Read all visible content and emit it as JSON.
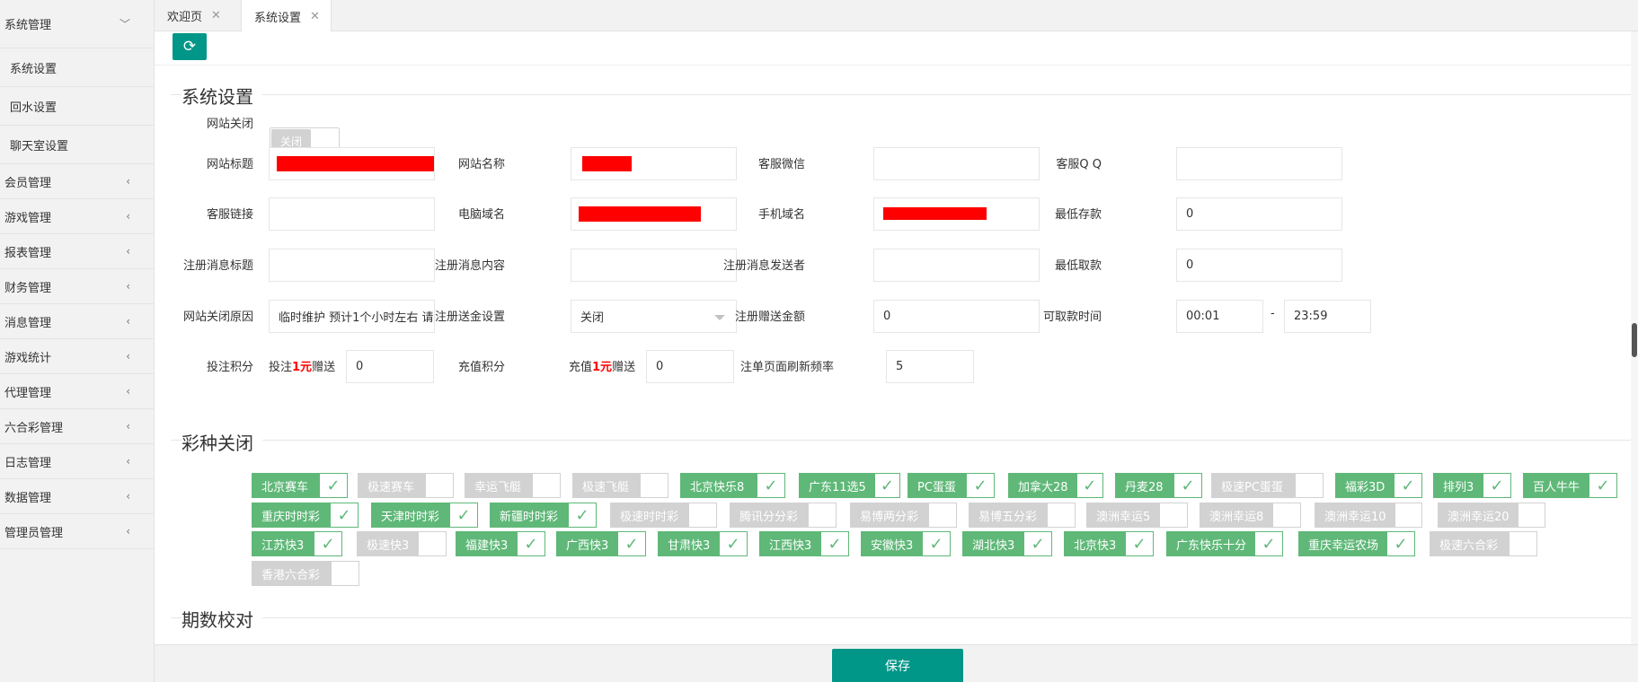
{
  "sidebar": {
    "items": [
      {
        "label": "系统管理",
        "arrow": "﹀"
      },
      {
        "label": "系统设置",
        "sub": true
      },
      {
        "label": "回水设置",
        "sub": true
      },
      {
        "label": "聊天室设置",
        "sub": true
      },
      {
        "label": "会员管理",
        "arrow": "‹"
      },
      {
        "label": "游戏管理",
        "arrow": "‹"
      },
      {
        "label": "报表管理",
        "arrow": "‹"
      },
      {
        "label": "财务管理",
        "arrow": "‹"
      },
      {
        "label": "消息管理",
        "arrow": "‹"
      },
      {
        "label": "游戏统计",
        "arrow": "‹"
      },
      {
        "label": "代理管理",
        "arrow": "‹"
      },
      {
        "label": "六合彩管理",
        "arrow": "‹"
      },
      {
        "label": "日志管理",
        "arrow": "‹"
      },
      {
        "label": "数据管理",
        "arrow": "‹"
      },
      {
        "label": "管理员管理",
        "arrow": "‹"
      }
    ]
  },
  "tabs": [
    {
      "label": "欢迎页",
      "close": "✕"
    },
    {
      "label": "系统设置",
      "close": "✕"
    }
  ],
  "refresh_icon": "⟳",
  "sections": {
    "system": "系统设置",
    "lottery": "彩种关闭",
    "period": "期数校对"
  },
  "form": {
    "site_close_label": "网站关闭",
    "site_close_switch": "关闭",
    "site_title_label": "网站标题",
    "site_name_label": "网站名称",
    "service_wechat_label": "客服微信",
    "service_qq_label": "客服Q Q",
    "service_link_label": "客服链接",
    "pc_domain_label": "电脑域名",
    "mobile_domain_label": "手机域名",
    "min_deposit_label": "最低存款",
    "min_deposit_value": "0",
    "reg_msg_title_label": "注册消息标题",
    "reg_msg_content_label": "注册消息内容",
    "reg_msg_sender_label": "注册消息发送者",
    "min_withdraw_label": "最低取款",
    "min_withdraw_value": "0",
    "close_reason_label": "网站关闭原因",
    "close_reason_value": "临时维护 预计1个小时左右 请",
    "reg_bonus_setting_label": "注册送金设置",
    "reg_bonus_setting_value": "关闭",
    "reg_bonus_amount_label": "注册赠送金额",
    "reg_bonus_amount_value": "0",
    "withdraw_time_label": "可取款时间",
    "withdraw_time_start": "00:01",
    "withdraw_time_sep": "-",
    "withdraw_time_end": "23:59",
    "bet_points_label": "投注积分",
    "bet_points_prefix": "投注",
    "bet_points_unit": "1元",
    "bet_points_suffix": "赠送",
    "bet_points_value": "0",
    "recharge_points_label": "充值积分",
    "recharge_points_prefix": "充值",
    "recharge_points_unit": "1元",
    "recharge_points_suffix": "赠送",
    "recharge_points_value": "0",
    "refresh_rate_label": "注单页面刷新频率",
    "refresh_rate_value": "5"
  },
  "lotteries": [
    {
      "name": "北京赛车",
      "on": true
    },
    {
      "name": "极速赛车",
      "on": false
    },
    {
      "name": "幸运飞艇",
      "on": false
    },
    {
      "name": "极速飞艇",
      "on": false
    },
    {
      "name": "北京快乐8",
      "on": true
    },
    {
      "name": "广东11选5",
      "on": true
    },
    {
      "name": "PC蛋蛋",
      "on": true
    },
    {
      "name": "加拿大28",
      "on": true
    },
    {
      "name": "丹麦28",
      "on": true
    },
    {
      "name": "极速PC蛋蛋",
      "on": false
    },
    {
      "name": "福彩3D",
      "on": true
    },
    {
      "name": "排列3",
      "on": true
    },
    {
      "name": "百人牛牛",
      "on": true
    },
    {
      "name": "重庆时时彩",
      "on": true
    },
    {
      "name": "天津时时彩",
      "on": true
    },
    {
      "name": "新疆时时彩",
      "on": true
    },
    {
      "name": "极速时时彩",
      "on": false
    },
    {
      "name": "腾讯分分彩",
      "on": false
    },
    {
      "name": "易博两分彩",
      "on": false
    },
    {
      "name": "易博五分彩",
      "on": false
    },
    {
      "name": "澳洲幸运5",
      "on": false
    },
    {
      "name": "澳洲幸运8",
      "on": false
    },
    {
      "name": "澳洲幸运10",
      "on": false
    },
    {
      "name": "澳洲幸运20",
      "on": false
    },
    {
      "name": "江苏快3",
      "on": true
    },
    {
      "name": "极速快3",
      "on": false
    },
    {
      "name": "福建快3",
      "on": true
    },
    {
      "name": "广西快3",
      "on": true
    },
    {
      "name": "甘肃快3",
      "on": true
    },
    {
      "name": "江西快3",
      "on": true
    },
    {
      "name": "安徽快3",
      "on": true
    },
    {
      "name": "湖北快3",
      "on": true
    },
    {
      "name": "北京快3",
      "on": true
    },
    {
      "name": "广东快乐十分",
      "on": true
    },
    {
      "name": "重庆幸运农场",
      "on": true
    },
    {
      "name": "极速六合彩",
      "on": false
    },
    {
      "name": "香港六合彩",
      "on": false
    }
  ],
  "check_icon": "✓",
  "save_label": "保存",
  "colors": {
    "primary": "#009688",
    "chip_on": "#5fb878",
    "chip_off": "#d2d2d2",
    "redaction": "#ff0000"
  }
}
